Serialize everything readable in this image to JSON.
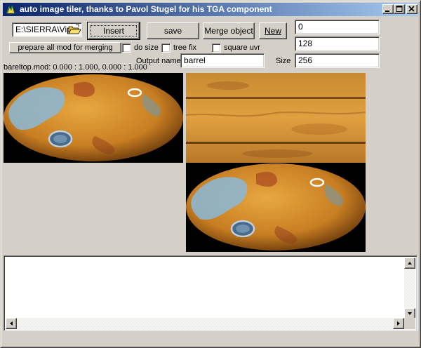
{
  "window": {
    "title": "auto image tiler, thanks to Pavol Stugel for his TGA component"
  },
  "toolbar": {
    "path_value": "E:\\SIERRA\\Vip",
    "insert_label": "Insert",
    "save_label": "save",
    "merge_label": "Merge object",
    "new_label": "New",
    "prepare_label": "prepare all mod for merging"
  },
  "fields": {
    "field1_value": "0",
    "field2_value": "128",
    "size_label": "Size",
    "size_value": "256",
    "output_name_label": "Output name",
    "output_name_value": "barrel"
  },
  "options": {
    "do_size_label": "do size",
    "tree_fix_label": "tree fix",
    "square_uvr_label": "square uvr",
    "do_size_checked": false,
    "tree_fix_checked": false,
    "square_uvr_checked": false
  },
  "status": {
    "mod_info": "bareltop.mod: 0.000 : 1.000, 0.000 : 1.000"
  },
  "log": {
    "text": ""
  },
  "colors": {
    "title_start": "#0a246a",
    "title_end": "#a6caf0",
    "face": "#d4d0c8",
    "barrel_orange": "#d4902e",
    "rust_blue": "#8ab8d8"
  },
  "icons": {
    "app": "app-icon",
    "folder": "folder-open-icon",
    "minimize": "minimize-icon",
    "maximize": "maximize-icon",
    "close": "close-icon"
  }
}
